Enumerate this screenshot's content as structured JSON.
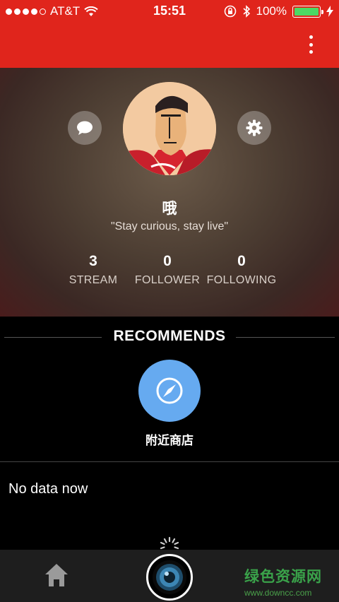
{
  "status_bar": {
    "carrier": "AT&T",
    "time": "15:51",
    "battery_percent": "100%",
    "icons": [
      "signal-dots-icon",
      "wifi-icon",
      "rotation-lock-icon",
      "bluetooth-icon",
      "battery-icon",
      "charging-icon"
    ]
  },
  "app_bar": {
    "menu_icon": "kebab-menu-icon",
    "accent_color": "#e0251c"
  },
  "profile": {
    "name": "哦",
    "motto": "\"Stay curious, stay live\"",
    "stats": [
      {
        "value": "3",
        "label": "STREAM"
      },
      {
        "value": "0",
        "label": "FOLLOWER"
      },
      {
        "value": "0",
        "label": "FOLLOWING"
      }
    ],
    "left_button_icon": "chat-bubble-icon",
    "right_button_icon": "gear-icon"
  },
  "recommends": {
    "title": "RECOMMENDS",
    "item_label": "附近商店",
    "item_icon": "compass-icon",
    "item_color": "#66aaf0"
  },
  "feed": {
    "empty_text": "No data now"
  },
  "bottom_bar": {
    "home_icon": "home-icon",
    "camera_icon": "camera-icon",
    "watermark_cn": "绿色资源网",
    "watermark_url": "www.downcc.com"
  }
}
